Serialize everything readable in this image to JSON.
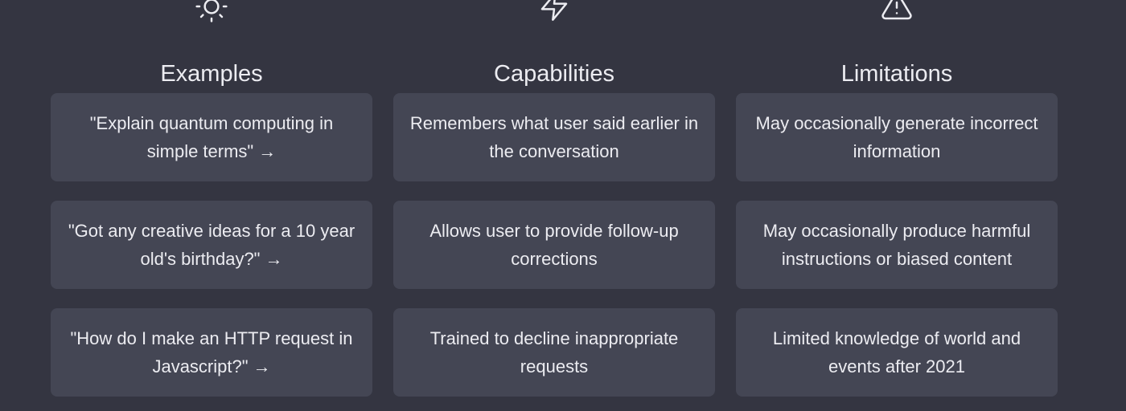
{
  "columns": [
    {
      "icon": "sun-icon",
      "title": "Examples",
      "items": [
        {
          "text": "\"Explain quantum computing in simple terms\"",
          "arrow": "→"
        },
        {
          "text": "\"Got any creative ideas for a 10 year old's birthday?\"",
          "arrow": "→"
        },
        {
          "text": "\"How do I make an HTTP request in Javascript?\"",
          "arrow": "→"
        }
      ]
    },
    {
      "icon": "lightning-bolt-icon",
      "title": "Capabilities",
      "items": [
        {
          "text": "Remembers what user said earlier in the conversation"
        },
        {
          "text": "Allows user to provide follow-up corrections"
        },
        {
          "text": "Trained to decline inappropriate requests"
        }
      ]
    },
    {
      "icon": "warning-triangle-icon",
      "title": "Limitations",
      "items": [
        {
          "text": "May occasionally generate incorrect information"
        },
        {
          "text": "May occasionally produce harmful instructions or biased content"
        },
        {
          "text": "Limited knowledge of world and events after 2021"
        }
      ]
    }
  ],
  "colors": {
    "background": "#343541",
    "card": "#444654",
    "text": "#ececf1"
  }
}
